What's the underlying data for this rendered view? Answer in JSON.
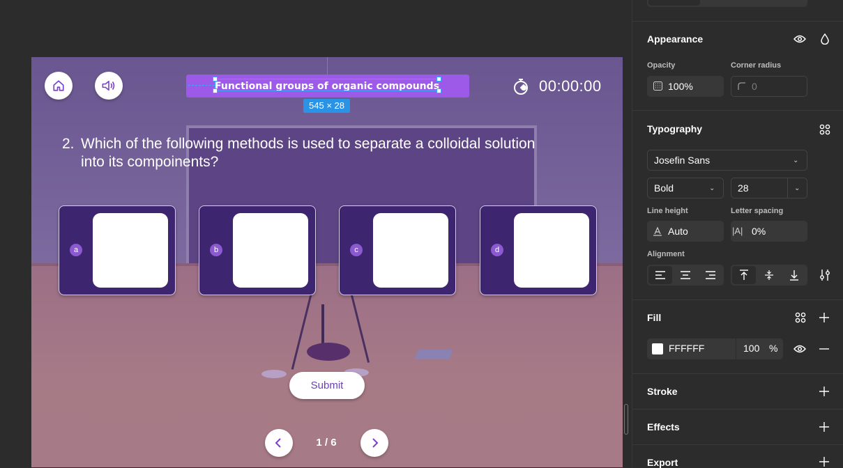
{
  "game": {
    "title": "Functional groups of organic compounds",
    "selection_size": "545 × 28",
    "timer": "00:00:00",
    "question_number": "2.",
    "question_text": "Which of the following methods is used to separate a colloidal solution into its compoinents?",
    "options": [
      {
        "letter": "a"
      },
      {
        "letter": "b"
      },
      {
        "letter": "c"
      },
      {
        "letter": "d"
      }
    ],
    "submit_label": "Submit",
    "pager": "1 / 6",
    "icons": [
      "home-icon",
      "speaker-icon",
      "stopwatch-icon",
      "chevron-left-icon",
      "chevron-right-icon"
    ]
  },
  "panel": {
    "appearance": {
      "title": "Appearance",
      "opacity_label": "Opacity",
      "opacity_value": "100%",
      "corner_radius_label": "Corner radius",
      "corner_radius_placeholder": "0"
    },
    "typography": {
      "title": "Typography",
      "font_family": "Josefin Sans",
      "font_weight": "Bold",
      "font_size": "28",
      "line_height_label": "Line height",
      "line_height_value": "Auto",
      "letter_spacing_label": "Letter spacing",
      "letter_spacing_value": "0%",
      "alignment_label": "Alignment"
    },
    "fill": {
      "title": "Fill",
      "color_hex": "FFFFFF",
      "opacity": "100",
      "percent": "%"
    },
    "stroke": {
      "title": "Stroke"
    },
    "effects": {
      "title": "Effects"
    },
    "export": {
      "title": "Export"
    }
  },
  "colors": {
    "accent_purple": "#9d59e8",
    "option_bg": "#3d2570",
    "selection_blue": "#3ea7f7"
  }
}
